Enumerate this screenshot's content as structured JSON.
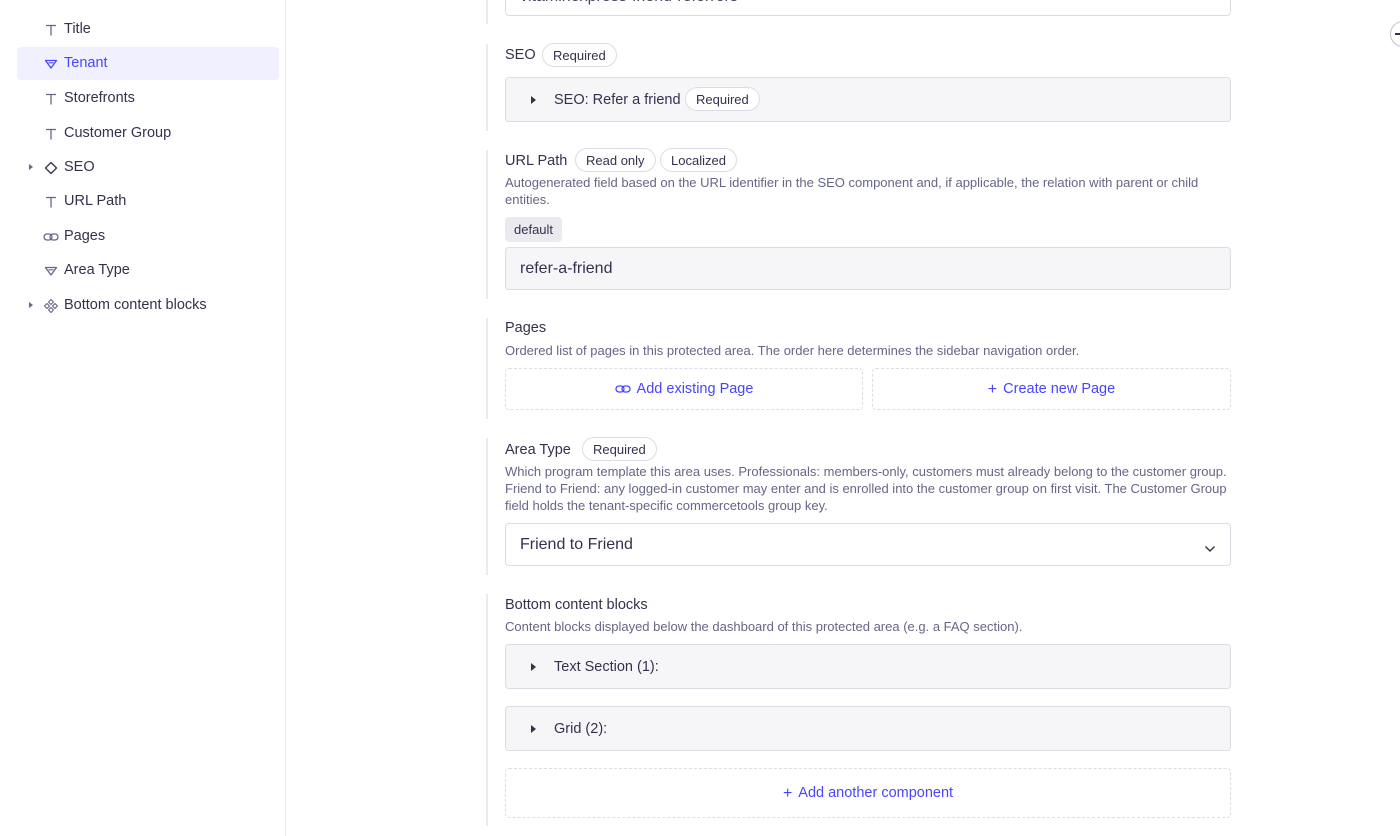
{
  "sidebar": {
    "items": [
      {
        "label": "Title",
        "icon": "text-icon",
        "expandable": false,
        "active": false
      },
      {
        "label": "Tenant",
        "icon": "enumeration-icon",
        "expandable": false,
        "active": true
      },
      {
        "label": "Storefronts",
        "icon": "text-icon",
        "expandable": false,
        "active": false
      },
      {
        "label": "Customer Group",
        "icon": "text-icon",
        "expandable": false,
        "active": false
      },
      {
        "label": "SEO",
        "icon": "component-icon",
        "expandable": true,
        "active": false
      },
      {
        "label": "URL Path",
        "icon": "text-icon",
        "expandable": false,
        "active": false
      },
      {
        "label": "Pages",
        "icon": "relation-icon",
        "expandable": false,
        "active": false
      },
      {
        "label": "Area Type",
        "icon": "enumeration-icon",
        "expandable": false,
        "active": false
      },
      {
        "label": "Bottom content blocks",
        "icon": "dynamic-zone-icon",
        "expandable": true,
        "active": false
      }
    ]
  },
  "fields": {
    "title_value": "vitaminexpress-friend-referrers",
    "seo": {
      "label": "SEO",
      "required_badge": "Required",
      "component_title": "SEO: Refer a friend",
      "component_badge": "Required"
    },
    "url_path": {
      "label": "URL Path",
      "badge_readonly": "Read only",
      "badge_localized": "Localized",
      "hint": "Autogenerated field based on the URL identifier in the SEO component and, if applicable, the relation with parent or child entities.",
      "locale_chip": "default",
      "value": "refer-a-friend"
    },
    "pages": {
      "label": "Pages",
      "hint": "Ordered list of pages in this protected area. The order here determines the sidebar navigation order.",
      "add_existing": "Add existing Page",
      "create_new": "Create new Page"
    },
    "area_type": {
      "label": "Area Type",
      "required_badge": "Required",
      "hint": "Which program template this area uses. Professionals: members-only, customers must already belong to the customer group. Friend to Friend: any logged-in customer may enter and is enrolled into the customer group on first visit. The Customer Group field holds the tenant-specific commercetools group key.",
      "value": "Friend to Friend"
    },
    "bottom_blocks": {
      "label": "Bottom content blocks",
      "hint": "Content blocks displayed below the dashboard of this protected area (e.g. a FAQ section).",
      "items": [
        "Text Section (1):",
        "Grid (2):"
      ],
      "add_component": "Add another component"
    }
  },
  "colors": {
    "accent": "#4945ff",
    "active_bg": "#f0f0ff",
    "text": "#32324d",
    "muted": "#666687",
    "border": "#dcdce4"
  }
}
